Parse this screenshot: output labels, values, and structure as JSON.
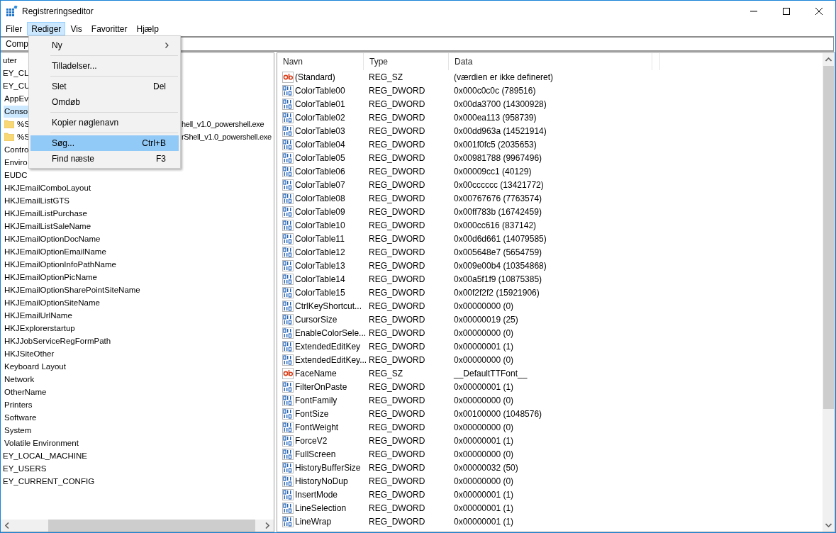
{
  "window": {
    "title": "Registreringseditor"
  },
  "menubar": [
    {
      "label": "Filer",
      "selected": false
    },
    {
      "label": "Rediger",
      "selected": true
    },
    {
      "label": "Vis",
      "selected": false
    },
    {
      "label": "Favoritter",
      "selected": false
    },
    {
      "label": "Hjælp",
      "selected": false
    }
  ],
  "edit_menu": [
    {
      "kind": "submenu",
      "label": "Ny",
      "selected": false
    },
    {
      "kind": "separator"
    },
    {
      "kind": "item",
      "label": "Tilladelser...",
      "selected": false
    },
    {
      "kind": "separator"
    },
    {
      "kind": "item",
      "label": "Slet",
      "shortcut": "Del",
      "selected": false
    },
    {
      "kind": "item",
      "label": "Omdøb",
      "selected": false
    },
    {
      "kind": "separator"
    },
    {
      "kind": "item",
      "label": "Kopier nøglenavn",
      "selected": false
    },
    {
      "kind": "separator"
    },
    {
      "kind": "item",
      "label": "Søg...",
      "shortcut": "Ctrl+B",
      "selected": true
    },
    {
      "kind": "item",
      "label": "Find næste",
      "shortcut": "F3",
      "selected": false
    }
  ],
  "address": "Comp",
  "tree": [
    {
      "text": "uter",
      "selected": false,
      "children": [
        {
          "text": "EY_CL",
          "selected": false
        },
        {
          "text": "EY_CU",
          "selected": false,
          "children": [
            {
              "text": "AppEv",
              "selected": false
            },
            {
              "text": "Conso",
              "selected": true,
              "children": [
                {
                  "text": "%S",
                  "text_tail": "hell_v1.0_powershell.exe",
                  "selected": false
                },
                {
                  "text": "%S",
                  "text_tail": "rShell_v1.0_powershell.exe",
                  "selected": false
                }
              ]
            },
            {
              "text": "Contro",
              "selected": false
            },
            {
              "text": "Enviro",
              "selected": false
            },
            {
              "text": "EUDC",
              "selected": false
            },
            {
              "text": "HKJEmailComboLayout",
              "selected": false
            },
            {
              "text": "HKJEmailListGTS",
              "selected": false
            },
            {
              "text": "HKJEmailListPurchase",
              "selected": false
            },
            {
              "text": "HKJEmailListSaleName",
              "selected": false
            },
            {
              "text": "HKJEmailOptionDocName",
              "selected": false
            },
            {
              "text": "HKJEmailOptionEmailName",
              "selected": false
            },
            {
              "text": "HKJEmailOptionInfoPathName",
              "selected": false
            },
            {
              "text": "HKJEmailOptionPicName",
              "selected": false
            },
            {
              "text": "HKJEmailOptionSharePointSiteName",
              "selected": false
            },
            {
              "text": "HKJEmailOptionSiteName",
              "selected": false
            },
            {
              "text": "HKJEmailUrlName",
              "selected": false
            },
            {
              "text": "HKJExplorerstartup",
              "selected": false
            },
            {
              "text": "HKJJobServiceRegFormPath",
              "selected": false
            },
            {
              "text": "HKJSiteOther",
              "selected": false
            },
            {
              "text": "Keyboard Layout",
              "selected": false
            },
            {
              "text": "Network",
              "selected": false
            },
            {
              "text": "OtherName",
              "selected": false
            },
            {
              "text": "Printers",
              "selected": false
            },
            {
              "text": "Software",
              "selected": false
            },
            {
              "text": "System",
              "selected": false
            },
            {
              "text": "Volatile Environment",
              "selected": false
            }
          ]
        },
        {
          "text": "EY_LOCAL_MACHINE",
          "selected": false
        },
        {
          "text": "EY_USERS",
          "selected": false
        },
        {
          "text": "EY_CURRENT_CONFIG",
          "selected": false
        }
      ]
    }
  ],
  "values": {
    "columns": [
      "Navn",
      "Type",
      "Data"
    ],
    "rows": [
      {
        "kind": "string",
        "name": "(Standard)",
        "type": "REG_SZ",
        "data": "(værdien er ikke defineret)"
      },
      {
        "kind": "dword",
        "name": "ColorTable00",
        "type": "REG_DWORD",
        "data": "0x000c0c0c (789516)"
      },
      {
        "kind": "dword",
        "name": "ColorTable01",
        "type": "REG_DWORD",
        "data": "0x00da3700 (14300928)"
      },
      {
        "kind": "dword",
        "name": "ColorTable02",
        "type": "REG_DWORD",
        "data": "0x000ea113 (958739)"
      },
      {
        "kind": "dword",
        "name": "ColorTable03",
        "type": "REG_DWORD",
        "data": "0x00dd963a (14521914)"
      },
      {
        "kind": "dword",
        "name": "ColorTable04",
        "type": "REG_DWORD",
        "data": "0x001f0fc5 (2035653)"
      },
      {
        "kind": "dword",
        "name": "ColorTable05",
        "type": "REG_DWORD",
        "data": "0x00981788 (9967496)"
      },
      {
        "kind": "dword",
        "name": "ColorTable06",
        "type": "REG_DWORD",
        "data": "0x00009cc1 (40129)"
      },
      {
        "kind": "dword",
        "name": "ColorTable07",
        "type": "REG_DWORD",
        "data": "0x00cccccc (13421772)"
      },
      {
        "kind": "dword",
        "name": "ColorTable08",
        "type": "REG_DWORD",
        "data": "0x00767676 (7763574)"
      },
      {
        "kind": "dword",
        "name": "ColorTable09",
        "type": "REG_DWORD",
        "data": "0x00ff783b (16742459)"
      },
      {
        "kind": "dword",
        "name": "ColorTable10",
        "type": "REG_DWORD",
        "data": "0x000cc616 (837142)"
      },
      {
        "kind": "dword",
        "name": "ColorTable11",
        "type": "REG_DWORD",
        "data": "0x00d6d661 (14079585)"
      },
      {
        "kind": "dword",
        "name": "ColorTable12",
        "type": "REG_DWORD",
        "data": "0x005648e7 (5654759)"
      },
      {
        "kind": "dword",
        "name": "ColorTable13",
        "type": "REG_DWORD",
        "data": "0x009e00b4 (10354868)"
      },
      {
        "kind": "dword",
        "name": "ColorTable14",
        "type": "REG_DWORD",
        "data": "0x00a5f1f9 (10875385)"
      },
      {
        "kind": "dword",
        "name": "ColorTable15",
        "type": "REG_DWORD",
        "data": "0x00f2f2f2 (15921906)"
      },
      {
        "kind": "dword",
        "name": "CtrlKeyShortcut...",
        "type": "REG_DWORD",
        "data": "0x00000000 (0)"
      },
      {
        "kind": "dword",
        "name": "CursorSize",
        "type": "REG_DWORD",
        "data": "0x00000019 (25)"
      },
      {
        "kind": "dword",
        "name": "EnableColorSele...",
        "type": "REG_DWORD",
        "data": "0x00000000 (0)"
      },
      {
        "kind": "dword",
        "name": "ExtendedEditKey",
        "type": "REG_DWORD",
        "data": "0x00000001 (1)"
      },
      {
        "kind": "dword",
        "name": "ExtendedEditKey...",
        "type": "REG_DWORD",
        "data": "0x00000000 (0)"
      },
      {
        "kind": "string",
        "name": "FaceName",
        "type": "REG_SZ",
        "data": "__DefaultTTFont__"
      },
      {
        "kind": "dword",
        "name": "FilterOnPaste",
        "type": "REG_DWORD",
        "data": "0x00000001 (1)"
      },
      {
        "kind": "dword",
        "name": "FontFamily",
        "type": "REG_DWORD",
        "data": "0x00000000 (0)"
      },
      {
        "kind": "dword",
        "name": "FontSize",
        "type": "REG_DWORD",
        "data": "0x00100000 (1048576)"
      },
      {
        "kind": "dword",
        "name": "FontWeight",
        "type": "REG_DWORD",
        "data": "0x00000000 (0)"
      },
      {
        "kind": "dword",
        "name": "ForceV2",
        "type": "REG_DWORD",
        "data": "0x00000001 (1)"
      },
      {
        "kind": "dword",
        "name": "FullScreen",
        "type": "REG_DWORD",
        "data": "0x00000000 (0)"
      },
      {
        "kind": "dword",
        "name": "HistoryBufferSize",
        "type": "REG_DWORD",
        "data": "0x00000032 (50)"
      },
      {
        "kind": "dword",
        "name": "HistoryNoDup",
        "type": "REG_DWORD",
        "data": "0x00000000 (0)"
      },
      {
        "kind": "dword",
        "name": "InsertMode",
        "type": "REG_DWORD",
        "data": "0x00000001 (1)"
      },
      {
        "kind": "dword",
        "name": "LineSelection",
        "type": "REG_DWORD",
        "data": "0x00000001 (1)"
      },
      {
        "kind": "dword",
        "name": "LineWrap",
        "type": "REG_DWORD",
        "data": "0x00000001 (1)"
      }
    ]
  }
}
